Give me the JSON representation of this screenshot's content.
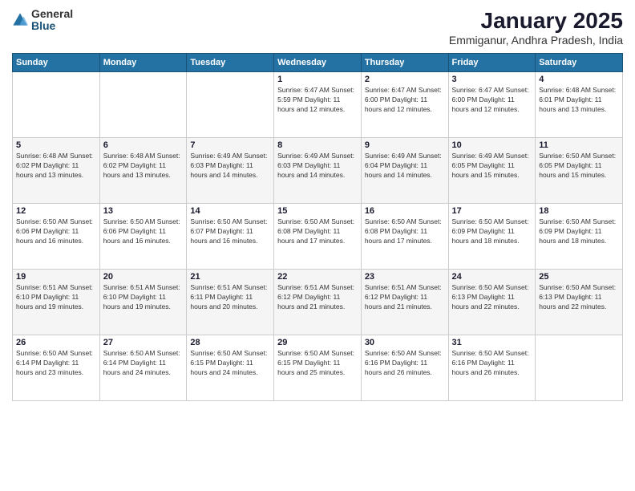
{
  "logo": {
    "general": "General",
    "blue": "Blue"
  },
  "header": {
    "month": "January 2025",
    "location": "Emmiganur, Andhra Pradesh, India"
  },
  "weekdays": [
    "Sunday",
    "Monday",
    "Tuesday",
    "Wednesday",
    "Thursday",
    "Friday",
    "Saturday"
  ],
  "weeks": [
    [
      {
        "day": "",
        "info": ""
      },
      {
        "day": "",
        "info": ""
      },
      {
        "day": "",
        "info": ""
      },
      {
        "day": "1",
        "info": "Sunrise: 6:47 AM\nSunset: 5:59 PM\nDaylight: 11 hours\nand 12 minutes."
      },
      {
        "day": "2",
        "info": "Sunrise: 6:47 AM\nSunset: 6:00 PM\nDaylight: 11 hours\nand 12 minutes."
      },
      {
        "day": "3",
        "info": "Sunrise: 6:47 AM\nSunset: 6:00 PM\nDaylight: 11 hours\nand 12 minutes."
      },
      {
        "day": "4",
        "info": "Sunrise: 6:48 AM\nSunset: 6:01 PM\nDaylight: 11 hours\nand 13 minutes."
      }
    ],
    [
      {
        "day": "5",
        "info": "Sunrise: 6:48 AM\nSunset: 6:02 PM\nDaylight: 11 hours\nand 13 minutes."
      },
      {
        "day": "6",
        "info": "Sunrise: 6:48 AM\nSunset: 6:02 PM\nDaylight: 11 hours\nand 13 minutes."
      },
      {
        "day": "7",
        "info": "Sunrise: 6:49 AM\nSunset: 6:03 PM\nDaylight: 11 hours\nand 14 minutes."
      },
      {
        "day": "8",
        "info": "Sunrise: 6:49 AM\nSunset: 6:03 PM\nDaylight: 11 hours\nand 14 minutes."
      },
      {
        "day": "9",
        "info": "Sunrise: 6:49 AM\nSunset: 6:04 PM\nDaylight: 11 hours\nand 14 minutes."
      },
      {
        "day": "10",
        "info": "Sunrise: 6:49 AM\nSunset: 6:05 PM\nDaylight: 11 hours\nand 15 minutes."
      },
      {
        "day": "11",
        "info": "Sunrise: 6:50 AM\nSunset: 6:05 PM\nDaylight: 11 hours\nand 15 minutes."
      }
    ],
    [
      {
        "day": "12",
        "info": "Sunrise: 6:50 AM\nSunset: 6:06 PM\nDaylight: 11 hours\nand 16 minutes."
      },
      {
        "day": "13",
        "info": "Sunrise: 6:50 AM\nSunset: 6:06 PM\nDaylight: 11 hours\nand 16 minutes."
      },
      {
        "day": "14",
        "info": "Sunrise: 6:50 AM\nSunset: 6:07 PM\nDaylight: 11 hours\nand 16 minutes."
      },
      {
        "day": "15",
        "info": "Sunrise: 6:50 AM\nSunset: 6:08 PM\nDaylight: 11 hours\nand 17 minutes."
      },
      {
        "day": "16",
        "info": "Sunrise: 6:50 AM\nSunset: 6:08 PM\nDaylight: 11 hours\nand 17 minutes."
      },
      {
        "day": "17",
        "info": "Sunrise: 6:50 AM\nSunset: 6:09 PM\nDaylight: 11 hours\nand 18 minutes."
      },
      {
        "day": "18",
        "info": "Sunrise: 6:50 AM\nSunset: 6:09 PM\nDaylight: 11 hours\nand 18 minutes."
      }
    ],
    [
      {
        "day": "19",
        "info": "Sunrise: 6:51 AM\nSunset: 6:10 PM\nDaylight: 11 hours\nand 19 minutes."
      },
      {
        "day": "20",
        "info": "Sunrise: 6:51 AM\nSunset: 6:10 PM\nDaylight: 11 hours\nand 19 minutes."
      },
      {
        "day": "21",
        "info": "Sunrise: 6:51 AM\nSunset: 6:11 PM\nDaylight: 11 hours\nand 20 minutes."
      },
      {
        "day": "22",
        "info": "Sunrise: 6:51 AM\nSunset: 6:12 PM\nDaylight: 11 hours\nand 21 minutes."
      },
      {
        "day": "23",
        "info": "Sunrise: 6:51 AM\nSunset: 6:12 PM\nDaylight: 11 hours\nand 21 minutes."
      },
      {
        "day": "24",
        "info": "Sunrise: 6:50 AM\nSunset: 6:13 PM\nDaylight: 11 hours\nand 22 minutes."
      },
      {
        "day": "25",
        "info": "Sunrise: 6:50 AM\nSunset: 6:13 PM\nDaylight: 11 hours\nand 22 minutes."
      }
    ],
    [
      {
        "day": "26",
        "info": "Sunrise: 6:50 AM\nSunset: 6:14 PM\nDaylight: 11 hours\nand 23 minutes."
      },
      {
        "day": "27",
        "info": "Sunrise: 6:50 AM\nSunset: 6:14 PM\nDaylight: 11 hours\nand 24 minutes."
      },
      {
        "day": "28",
        "info": "Sunrise: 6:50 AM\nSunset: 6:15 PM\nDaylight: 11 hours\nand 24 minutes."
      },
      {
        "day": "29",
        "info": "Sunrise: 6:50 AM\nSunset: 6:15 PM\nDaylight: 11 hours\nand 25 minutes."
      },
      {
        "day": "30",
        "info": "Sunrise: 6:50 AM\nSunset: 6:16 PM\nDaylight: 11 hours\nand 26 minutes."
      },
      {
        "day": "31",
        "info": "Sunrise: 6:50 AM\nSunset: 6:16 PM\nDaylight: 11 hours\nand 26 minutes."
      },
      {
        "day": "",
        "info": ""
      }
    ]
  ]
}
